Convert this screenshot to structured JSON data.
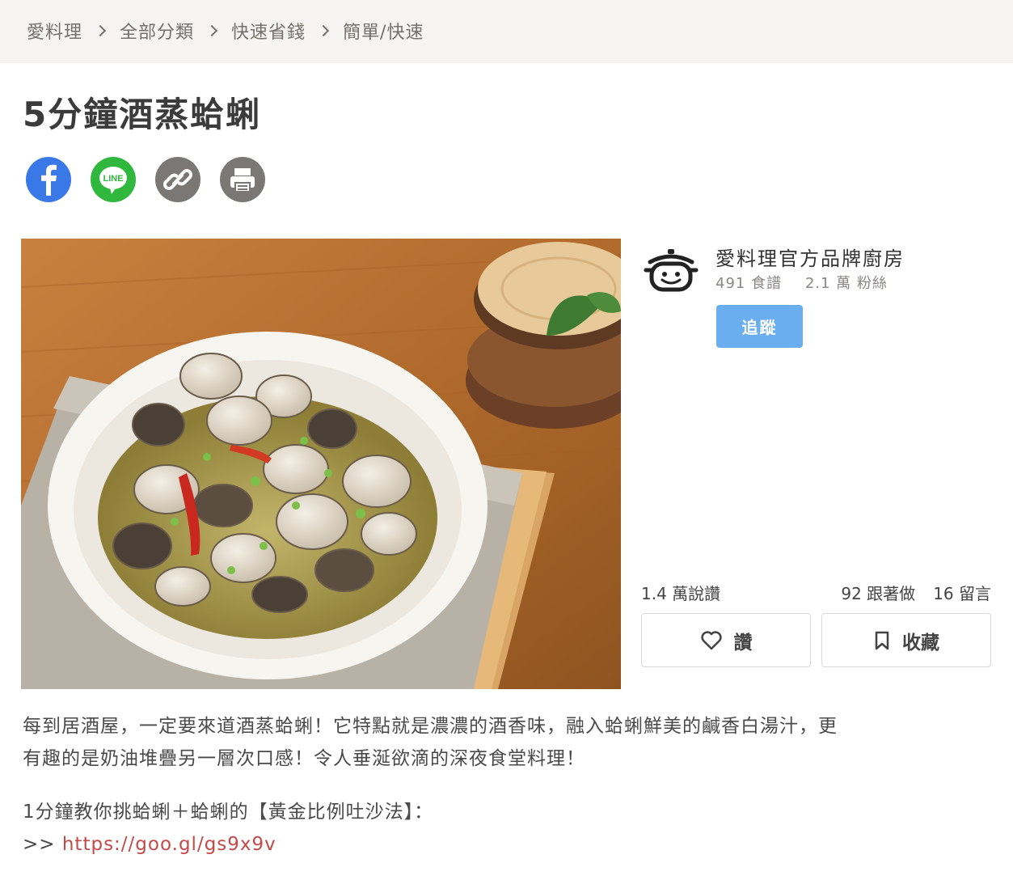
{
  "breadcrumb": [
    "愛料理",
    "全部分類",
    "快速省錢",
    "簡單/快速"
  ],
  "title": "5分鐘酒蒸蛤蜊",
  "share": {
    "facebook": "facebook-icon",
    "line": "LINE",
    "link": "link-icon",
    "print": "print-icon"
  },
  "author": {
    "name": "愛料理官方品牌廚房",
    "recipes": "491 食譜",
    "fans": "2.1 萬 粉絲",
    "follow_label": "追蹤"
  },
  "stats": {
    "likes": "1.4 萬說讚",
    "cooked": "92 跟著做",
    "comments": "16 留言"
  },
  "actions": {
    "like_label": "讚",
    "favorite_label": "收藏"
  },
  "description": {
    "line1": "每到居酒屋，一定要來道酒蒸蛤蜊！它特點就是濃濃的酒香味，融入蛤蜊鮮美的鹹香白湯汁，更",
    "line2": "有趣的是奶油堆疊另一層次口感！令人垂涎欲滴的深夜食堂料理！",
    "line3": "1分鐘教你挑蛤蜊＋蛤蜊的【黃金比例吐沙法】：",
    "link_prefix": ">> ",
    "link": "https://goo.gl/gs9x9v"
  },
  "colors": {
    "facebook": "#3b78e7",
    "line": "#2fb83d",
    "follow": "#6aaef0",
    "link": "#c44a4a"
  }
}
